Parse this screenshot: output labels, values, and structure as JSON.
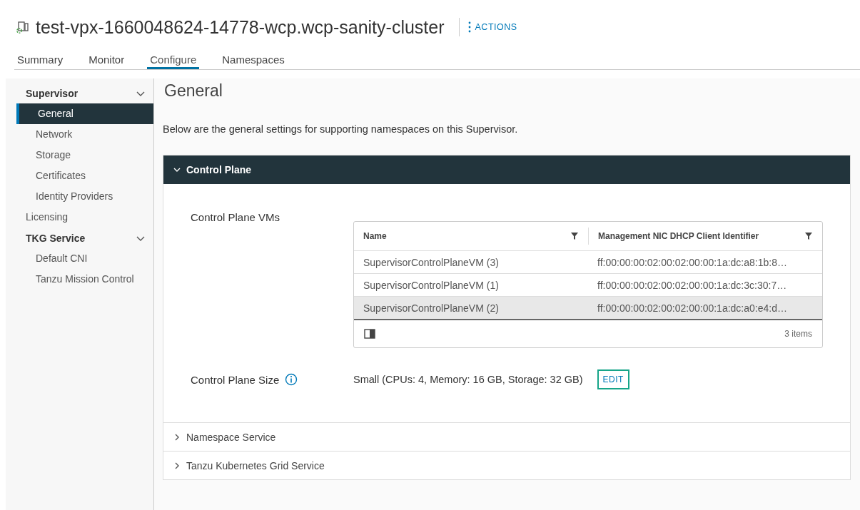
{
  "header": {
    "title": "test-vpx-1660048624-14778-wcp.wcp-sanity-cluster",
    "actions": "ACTIONS"
  },
  "tabs": [
    {
      "label": "Summary",
      "selected": false
    },
    {
      "label": "Monitor",
      "selected": false
    },
    {
      "label": "Configure",
      "selected": true
    },
    {
      "label": "Namespaces",
      "selected": false
    }
  ],
  "sidebar": {
    "items": [
      {
        "label": "Supervisor",
        "kind": "section",
        "expanded": true,
        "children": [
          {
            "label": "General",
            "selected": true
          },
          {
            "label": "Network",
            "selected": false
          },
          {
            "label": "Storage",
            "selected": false
          },
          {
            "label": "Certificates",
            "selected": false
          },
          {
            "label": "Identity Providers",
            "selected": false
          }
        ]
      },
      {
        "label": "Licensing",
        "kind": "item",
        "selected": false
      },
      {
        "label": "TKG Service",
        "kind": "section",
        "expanded": true,
        "children": [
          {
            "label": "Default CNI",
            "selected": false
          },
          {
            "label": "Tanzu Mission Control",
            "selected": false
          }
        ]
      }
    ]
  },
  "content": {
    "title": "General",
    "description": "Below are the general settings for supporting namespaces on this Supervisor.",
    "panels": [
      {
        "title": "Control Plane",
        "expanded": true,
        "vms_label": "Control Plane VMs",
        "table": {
          "columns": [
            "Name",
            "Management NIC DHCP Client Identifier"
          ],
          "rows": [
            {
              "cells": [
                "SupervisorControlPlaneVM (3)",
                "ff:00:00:00:02:00:02:00:00:1a:dc:a8:1b:8…"
              ],
              "selected": false
            },
            {
              "cells": [
                "SupervisorControlPlaneVM (1)",
                "ff:00:00:00:02:00:02:00:00:1a:dc:3c:30:7…"
              ],
              "selected": false
            },
            {
              "cells": [
                "SupervisorControlPlaneVM (2)",
                "ff:00:00:00:02:00:02:00:00:1a:dc:a0:e4:d…"
              ],
              "selected": true
            }
          ],
          "footer": "3 items"
        },
        "size_label": "Control Plane Size",
        "size_value": "Small (CPUs: 4, Memory: 16 GB, Storage: 32 GB)",
        "edit": "EDIT"
      },
      {
        "title": "Namespace Service",
        "expanded": false
      },
      {
        "title": "Tanzu Kubernetes Grid Service",
        "expanded": false
      }
    ]
  }
}
